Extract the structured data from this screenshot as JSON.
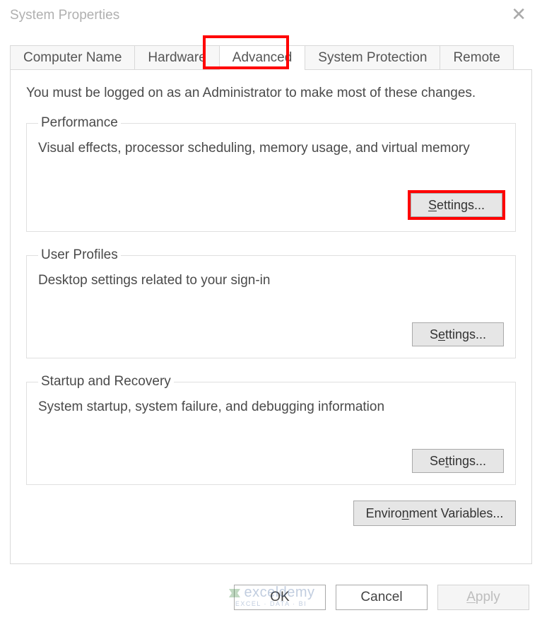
{
  "window": {
    "title": "System Properties"
  },
  "tabs": {
    "computer_name": "Computer Name",
    "hardware": "Hardware",
    "advanced": "Advanced",
    "system_protection": "System Protection",
    "remote": "Remote",
    "active_index": 2
  },
  "panel": {
    "intro": "You must be logged on as an Administrator to make most of these changes."
  },
  "groups": {
    "performance": {
      "legend": "Performance",
      "desc": "Visual effects, processor scheduling, memory usage, and virtual memory",
      "button": "Settings..."
    },
    "user_profiles": {
      "legend": "User Profiles",
      "desc": "Desktop settings related to your sign-in",
      "button": "Settings..."
    },
    "startup_recovery": {
      "legend": "Startup and Recovery",
      "desc": "System startup, system failure, and debugging information",
      "button": "Settings..."
    }
  },
  "env_button": "Environment Variables...",
  "dialog_buttons": {
    "ok": "OK",
    "cancel": "Cancel",
    "apply": "Apply"
  },
  "highlights": {
    "tab_advanced": true,
    "performance_settings": true
  },
  "watermark": {
    "brand": "exceldemy",
    "sub": "EXCEL · DATA · BI"
  }
}
